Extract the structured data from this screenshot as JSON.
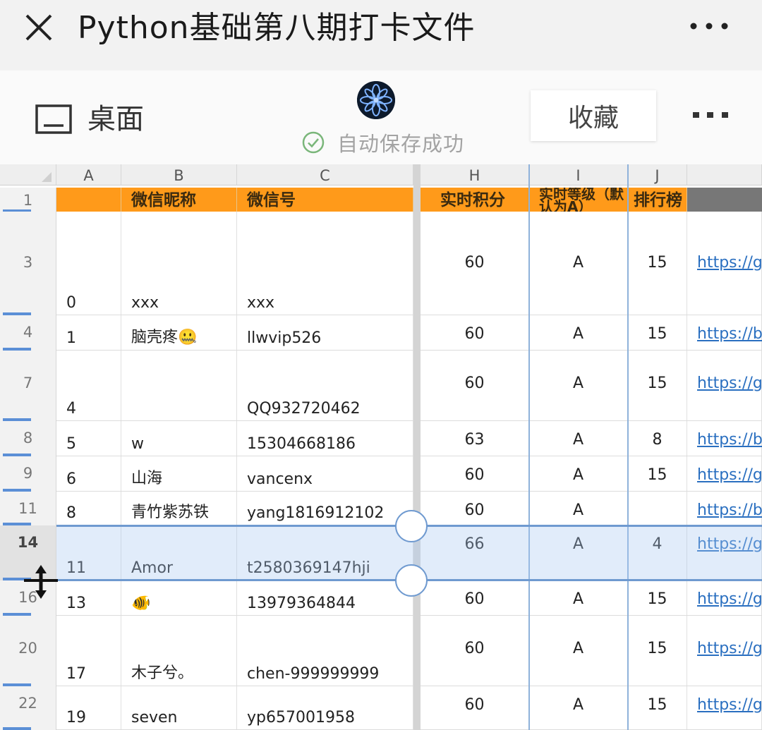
{
  "titlebar": {
    "title": "Python基础第八期打卡文件"
  },
  "toolbar": {
    "desktop_label": "桌面",
    "save_status": "自动保存成功",
    "favorite_label": "收藏"
  },
  "sheet": {
    "columns": [
      "A",
      "B",
      "C",
      "H",
      "I",
      "J"
    ],
    "header_row_number": "1",
    "headers": [
      "",
      "微信昵称",
      "微信号",
      "实时积分",
      "实时等级（默认为A）",
      "排行榜"
    ],
    "rows": [
      {
        "num": "3",
        "a": "0",
        "b": "xxx",
        "c": "xxx",
        "h": "60",
        "i": "A",
        "j": "15",
        "link": "https://g"
      },
      {
        "num": "4",
        "a": "1",
        "b": "脑壳疼🤐",
        "c": "llwvip526",
        "h": "60",
        "i": "A",
        "j": "15",
        "link": "https://b"
      },
      {
        "num": "7",
        "a": "4",
        "b": "",
        "c": "QQ932720462",
        "h": "60",
        "i": "A",
        "j": "15",
        "link": "https://g"
      },
      {
        "num": "8",
        "a": "5",
        "b": "w",
        "c": "15304668186",
        "h": "63",
        "i": "A",
        "j": "8",
        "link": "https://b"
      },
      {
        "num": "9",
        "a": "6",
        "b": "山海",
        "c": "vancenx",
        "h": "60",
        "i": "A",
        "j": "15",
        "link": "https://g"
      },
      {
        "num": "11",
        "a": "8",
        "b": "青竹紫苏铁",
        "c": "yang1816912102",
        "h": "60",
        "i": "A",
        "j": "",
        "link": "https://b"
      },
      {
        "num": "14",
        "a": "11",
        "b": "Amor",
        "c": "t2580369147hji",
        "h": "66",
        "i": "A",
        "j": "4",
        "link": "https://g"
      },
      {
        "num": "16",
        "a": "13",
        "b": "🐠",
        "c": "13979364844",
        "h": "60",
        "i": "A",
        "j": "15",
        "link": "https://g"
      },
      {
        "num": "20",
        "a": "17",
        "b": "木子兮。",
        "c": "chen-999999999",
        "h": "60",
        "i": "A",
        "j": "15",
        "link": "https://g"
      },
      {
        "num": "22",
        "a": "19",
        "b": "seven",
        "c": "yp657001958",
        "h": "60",
        "i": "A",
        "j": "15",
        "link": "https://g"
      }
    ]
  },
  "colors": {
    "header_fill": "#ff9a1a",
    "selection": "#6f9ad0",
    "link": "#2a6fc0"
  }
}
